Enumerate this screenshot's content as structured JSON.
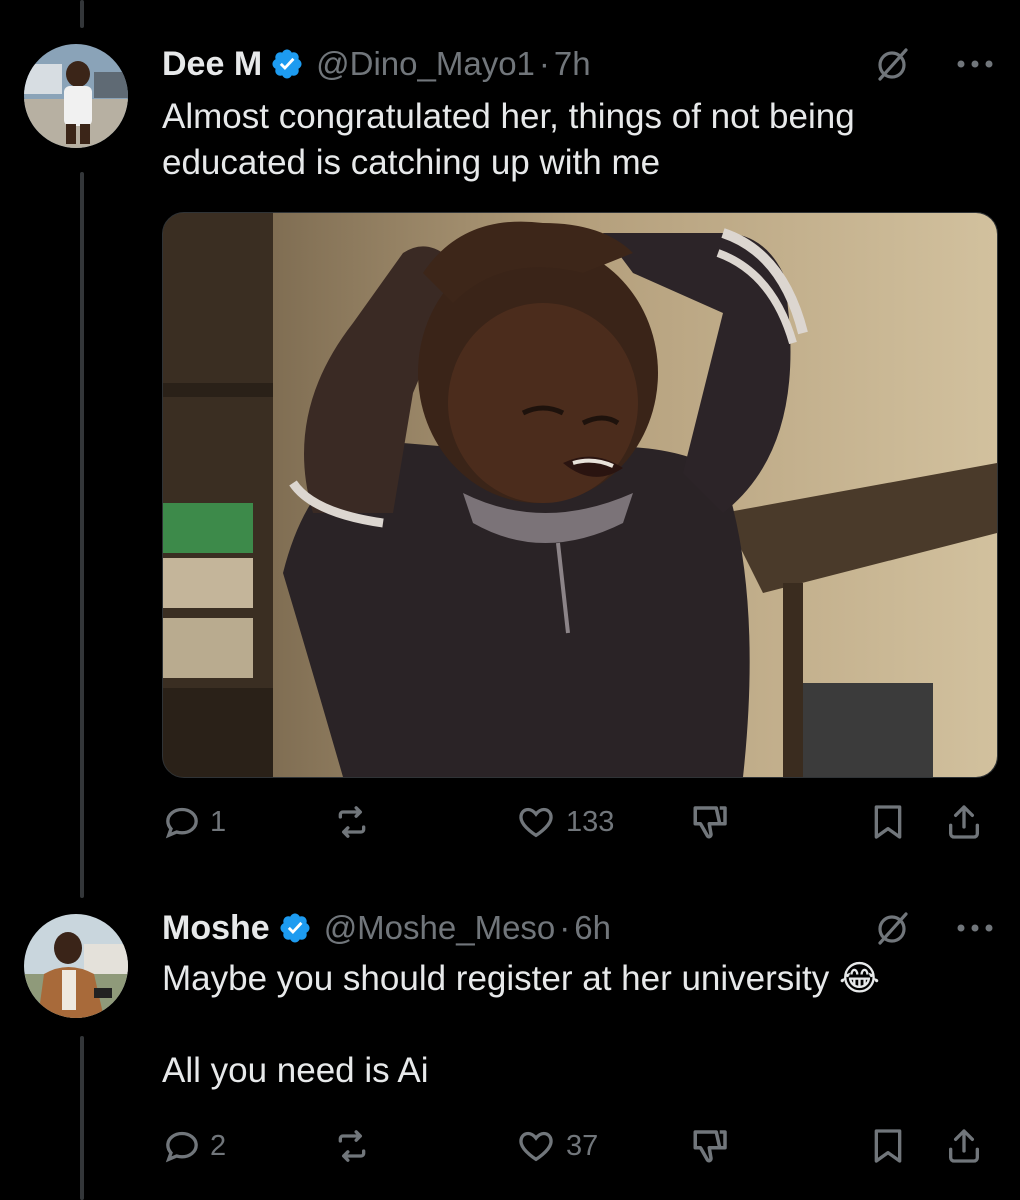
{
  "tweets": [
    {
      "display_name": "Dee M",
      "handle": "@Dino_Mayo1",
      "separator": "·",
      "time": "7h",
      "text": "Almost congratulated her, things of not being\neducated is catching up with me",
      "has_media": true,
      "replies": "1",
      "reposts": "",
      "likes": "133"
    },
    {
      "display_name": "Moshe",
      "handle": "@Moshe_Meso",
      "separator": "·",
      "time": "6h",
      "text": "Maybe you should register at her university 😂\n\nAll you need is Ai",
      "has_media": false,
      "replies": "2",
      "reposts": "",
      "likes": "37"
    }
  ],
  "icons": {
    "verified": "verified-badge-icon",
    "grok": "grok-icon",
    "more": "more-icon",
    "reply": "reply-icon",
    "repost": "repost-icon",
    "like": "like-icon",
    "dislike": "dislike-icon",
    "bookmark": "bookmark-icon",
    "share": "share-icon"
  },
  "colors": {
    "background": "#000000",
    "text": "#e7e9ea",
    "secondary": "#71767b",
    "verified": "#1d9bf0",
    "thread_line": "#333639"
  }
}
